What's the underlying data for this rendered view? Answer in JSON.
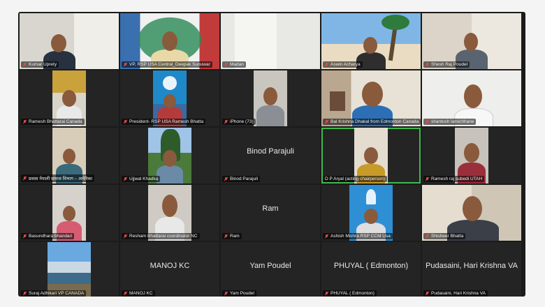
{
  "participants": [
    {
      "name": "Kumar Uprety",
      "big_name": "",
      "muted": true,
      "active": false
    },
    {
      "name": "VP, RSP USA Central_Deepak Sunuwar",
      "big_name": "",
      "muted": true,
      "active": false
    },
    {
      "name": "Madan",
      "big_name": "",
      "muted": true,
      "active": false
    },
    {
      "name": "Aswin Acharya",
      "big_name": "",
      "muted": true,
      "active": false
    },
    {
      "name": "Shesh Raj Poudel",
      "big_name": "",
      "muted": true,
      "active": false
    },
    {
      "name": "Ramesh Bhattarai Canada",
      "big_name": "",
      "muted": true,
      "active": false
    },
    {
      "name": "President- RSP USA Ramesh Bhatta",
      "big_name": "",
      "muted": true,
      "active": false
    },
    {
      "name": "iPhone (73)",
      "big_name": "",
      "muted": true,
      "active": false
    },
    {
      "name": "Bal Krishna Dhakal from Edmonton Canada",
      "big_name": "",
      "muted": true,
      "active": false
    },
    {
      "name": "shantosh lamichhane",
      "big_name": "",
      "muted": true,
      "active": false
    },
    {
      "name": "प्रवास नेपाली समाज विभाग – अमेरिका",
      "big_name": "",
      "muted": true,
      "active": false
    },
    {
      "name": "Ujjwal Khadka",
      "big_name": "",
      "muted": true,
      "active": false
    },
    {
      "name": "Binod Parajuli",
      "big_name": "Binod Parajuli",
      "muted": true,
      "active": false
    },
    {
      "name": "D P Aryal (acting chairperson)",
      "big_name": "",
      "muted": false,
      "active": true
    },
    {
      "name": "Ramesh raj subedi UTAH",
      "big_name": "",
      "muted": true,
      "active": false
    },
    {
      "name": "Basundhara bhandari",
      "big_name": "",
      "muted": true,
      "active": false
    },
    {
      "name": "Resham Bhattarai coordinator NC",
      "big_name": "",
      "muted": true,
      "active": false
    },
    {
      "name": "Ram",
      "big_name": "Ram",
      "muted": true,
      "active": false
    },
    {
      "name": "Ashish Mishra RSP CCM Usa",
      "big_name": "",
      "muted": true,
      "active": false
    },
    {
      "name": "Shisheer Bhatta",
      "big_name": "",
      "muted": true,
      "active": false
    },
    {
      "name": "Suraj Adhikari VP CANADA",
      "big_name": "",
      "muted": true,
      "active": false
    },
    {
      "name": "MANOJ KC",
      "big_name": "MANOJ KC",
      "muted": true,
      "active": false
    },
    {
      "name": "Yam  Poudel",
      "big_name": "Yam  Poudel",
      "muted": true,
      "active": false
    },
    {
      "name": "PHUYAL ( Edmonton)",
      "big_name": "PHUYAL ( Edmonton)",
      "muted": true,
      "active": false
    },
    {
      "name": "Pudasaini, Hari Krishna  VA",
      "big_name": "Pudasaini, Hari Krishna  VA",
      "muted": true,
      "active": false
    }
  ],
  "colors": {
    "active_border": "#3fb950",
    "muted_icon": "#e5484d",
    "tile_bg": "#242424"
  }
}
